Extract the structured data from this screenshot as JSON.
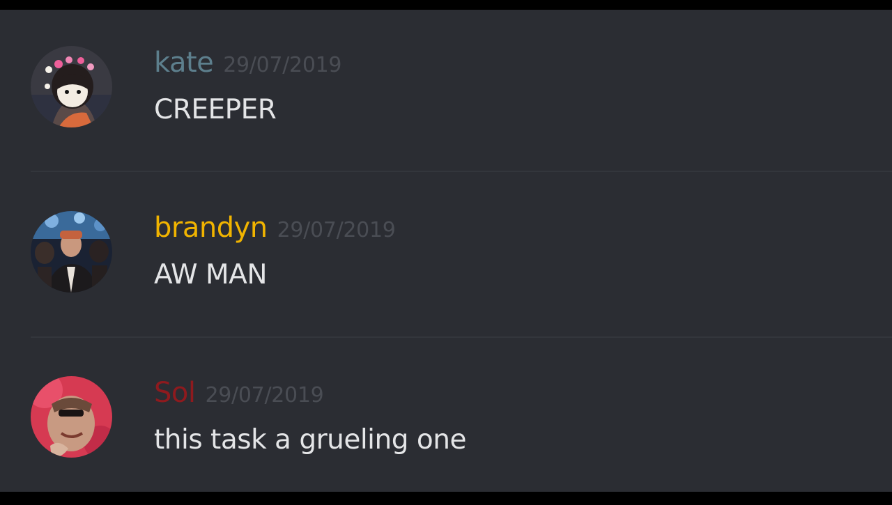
{
  "messages": [
    {
      "username": "kate",
      "username_color": "#5d7f8d",
      "timestamp": "29/07/2019",
      "text": "CREEPER"
    },
    {
      "username": "brandyn",
      "username_color": "#f1b400",
      "timestamp": "29/07/2019",
      "text": "AW MAN"
    },
    {
      "username": "Sol",
      "username_color": "#8e1a1e",
      "timestamp": "29/07/2019",
      "text": "this task a grueling one"
    }
  ],
  "colors": {
    "background": "#2b2d33",
    "letterbox": "#000000",
    "timestamp": "#4a4d54",
    "message_text": "#e4e5e7",
    "divider": "#33363c"
  }
}
